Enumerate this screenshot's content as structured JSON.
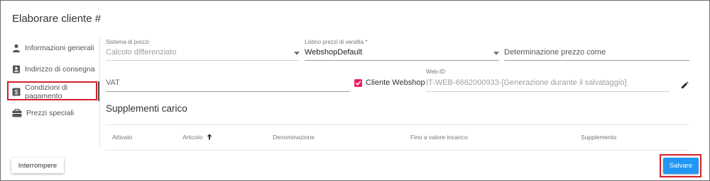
{
  "dialog": {
    "title": "Elaborare cliente #"
  },
  "sidebar": {
    "items": [
      {
        "label": "Informazioni generali",
        "icon": "person-icon"
      },
      {
        "label": "Indirizzo di consegna",
        "icon": "contact-card-icon"
      },
      {
        "label": "Condizioni di pagamento",
        "icon": "dollar-icon",
        "active": true
      },
      {
        "label": "Prezzi speciali",
        "icon": "tag-icon"
      }
    ]
  },
  "form": {
    "price_system": {
      "label": "Sistema di prezzi",
      "value": "Calcolo differenziato"
    },
    "price_list": {
      "label": "Listino prezzi di vendita *",
      "value": "WebshopDefault"
    },
    "price_determination": {
      "placeholder": "Determinazione prezzo come"
    },
    "vat": {
      "placeholder": "VAT"
    },
    "webshop_customer": {
      "label": "Cliente Webshop",
      "checked": true
    },
    "web_id": {
      "label": "Web-ID",
      "value": "IT-WEB-6662000933-[Generazione durante il salvataggio]"
    }
  },
  "surcharges": {
    "title": "Supplementi carico",
    "columns": [
      "Attivato",
      "Articolo",
      "Denominazione",
      "Fino a valore incarico",
      "Supplemento"
    ]
  },
  "footer": {
    "cancel_label": "Interrompere",
    "save_label": "Salvare"
  },
  "colors": {
    "accent": "#2196f3",
    "checkbox": "#e91e63",
    "highlight": "#d42027"
  }
}
